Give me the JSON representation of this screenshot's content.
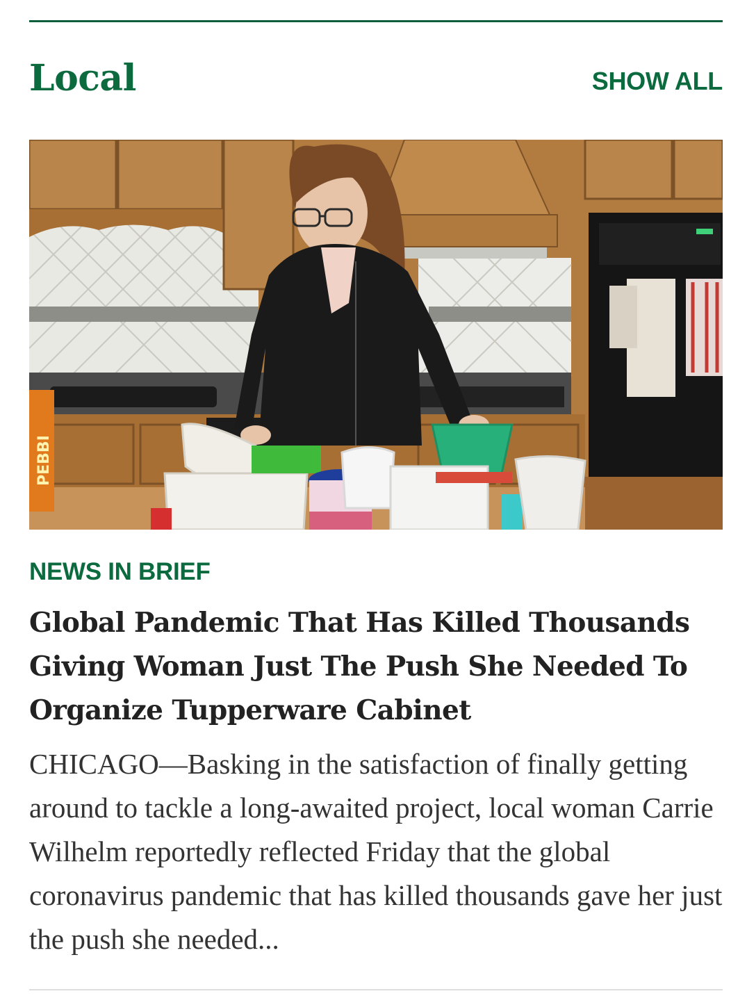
{
  "section": {
    "title": "Local",
    "show_all_label": "SHOW ALL"
  },
  "article": {
    "kicker": "NEWS IN BRIEF",
    "headline": "Global Pandemic That Has Killed Thousands Giving Woman Just The Push She Needed To Organize Tupperware Cabinet",
    "excerpt": "CHICAGO—Basking in the satisfaction of finally getting around to tackle a long-awaited project, local woman Carrie Wilhelm reportedly reflected Friday that the global coronavirus pandemic that has killed thousands gave her just the push she needed...",
    "image": {
      "box_label": "PEBBI"
    }
  },
  "colors": {
    "accent": "#0b6b3f",
    "rule": "#0b5e3b",
    "headline": "#222222",
    "body": "#333333"
  }
}
